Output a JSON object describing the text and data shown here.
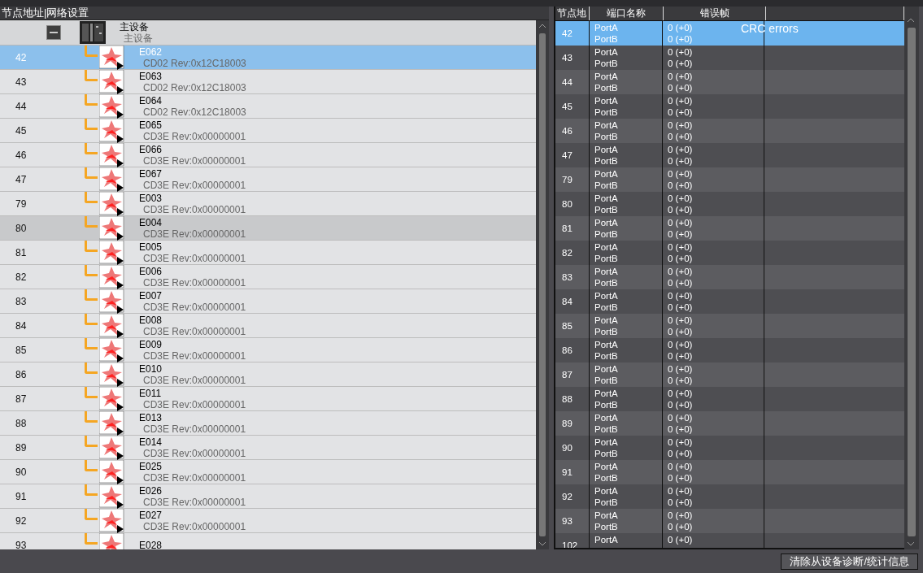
{
  "left_panel": {
    "header": "节点地址|网络设置",
    "master": {
      "name": "主设备",
      "subtitle": "主设备",
      "expanded": true
    },
    "rows": [
      {
        "node": "42",
        "name": "E062",
        "desc": "CD02 Rev:0x12C18003",
        "selected": true,
        "hovered": false
      },
      {
        "node": "43",
        "name": "E063",
        "desc": "CD02 Rev:0x12C18003",
        "selected": false,
        "hovered": false
      },
      {
        "node": "44",
        "name": "E064",
        "desc": "CD02 Rev:0x12C18003",
        "selected": false,
        "hovered": false
      },
      {
        "node": "45",
        "name": "E065",
        "desc": "CD3E Rev:0x00000001",
        "selected": false,
        "hovered": false
      },
      {
        "node": "46",
        "name": "E066",
        "desc": "CD3E Rev:0x00000001",
        "selected": false,
        "hovered": false
      },
      {
        "node": "47",
        "name": "E067",
        "desc": "CD3E Rev:0x00000001",
        "selected": false,
        "hovered": false
      },
      {
        "node": "79",
        "name": "E003",
        "desc": "CD3E Rev:0x00000001",
        "selected": false,
        "hovered": false
      },
      {
        "node": "80",
        "name": "E004",
        "desc": "CD3E Rev:0x00000001",
        "selected": false,
        "hovered": true
      },
      {
        "node": "81",
        "name": "E005",
        "desc": "CD3E Rev:0x00000001",
        "selected": false,
        "hovered": false
      },
      {
        "node": "82",
        "name": "E006",
        "desc": "CD3E Rev:0x00000001",
        "selected": false,
        "hovered": false
      },
      {
        "node": "83",
        "name": "E007",
        "desc": "CD3E Rev:0x00000001",
        "selected": false,
        "hovered": false
      },
      {
        "node": "84",
        "name": "E008",
        "desc": "CD3E Rev:0x00000001",
        "selected": false,
        "hovered": false
      },
      {
        "node": "85",
        "name": "E009",
        "desc": "CD3E Rev:0x00000001",
        "selected": false,
        "hovered": false
      },
      {
        "node": "86",
        "name": "E010",
        "desc": "CD3E Rev:0x00000001",
        "selected": false,
        "hovered": false
      },
      {
        "node": "87",
        "name": "E011",
        "desc": "CD3E Rev:0x00000001",
        "selected": false,
        "hovered": false
      },
      {
        "node": "88",
        "name": "E013",
        "desc": "CD3E Rev:0x00000001",
        "selected": false,
        "hovered": false
      },
      {
        "node": "89",
        "name": "E014",
        "desc": "CD3E Rev:0x00000001",
        "selected": false,
        "hovered": false
      },
      {
        "node": "90",
        "name": "E025",
        "desc": "CD3E Rev:0x00000001",
        "selected": false,
        "hovered": false
      },
      {
        "node": "91",
        "name": "E026",
        "desc": "CD3E Rev:0x00000001",
        "selected": false,
        "hovered": false
      },
      {
        "node": "92",
        "name": "E027",
        "desc": "CD3E Rev:0x00000001",
        "selected": false,
        "hovered": false
      },
      {
        "node": "93",
        "name": "E028",
        "selected": false,
        "hovered": false
      }
    ]
  },
  "right_panel": {
    "columns": [
      "节点地",
      "端口名称",
      "错误帧"
    ],
    "tooltip": "CRC errors",
    "rows": [
      {
        "node": "42",
        "ports": [
          "PortA",
          "PortB"
        ],
        "errors": [
          "0 (+0)",
          "0 (+0)"
        ],
        "selected": true
      },
      {
        "node": "43",
        "ports": [
          "PortA",
          "PortB"
        ],
        "errors": [
          "0 (+0)",
          "0 (+0)"
        ],
        "selected": false
      },
      {
        "node": "44",
        "ports": [
          "PortA",
          "PortB"
        ],
        "errors": [
          "0 (+0)",
          "0 (+0)"
        ],
        "selected": false
      },
      {
        "node": "45",
        "ports": [
          "PortA",
          "PortB"
        ],
        "errors": [
          "0 (+0)",
          "0 (+0)"
        ],
        "selected": false
      },
      {
        "node": "46",
        "ports": [
          "PortA",
          "PortB"
        ],
        "errors": [
          "0 (+0)",
          "0 (+0)"
        ],
        "selected": false
      },
      {
        "node": "47",
        "ports": [
          "PortA",
          "PortB"
        ],
        "errors": [
          "0 (+0)",
          "0 (+0)"
        ],
        "selected": false
      },
      {
        "node": "79",
        "ports": [
          "PortA",
          "PortB"
        ],
        "errors": [
          "0 (+0)",
          "0 (+0)"
        ],
        "selected": false
      },
      {
        "node": "80",
        "ports": [
          "PortA",
          "PortB"
        ],
        "errors": [
          "0 (+0)",
          "0 (+0)"
        ],
        "selected": false
      },
      {
        "node": "81",
        "ports": [
          "PortA",
          "PortB"
        ],
        "errors": [
          "0 (+0)",
          "0 (+0)"
        ],
        "selected": false
      },
      {
        "node": "82",
        "ports": [
          "PortA",
          "PortB"
        ],
        "errors": [
          "0 (+0)",
          "0 (+0)"
        ],
        "selected": false
      },
      {
        "node": "83",
        "ports": [
          "PortA",
          "PortB"
        ],
        "errors": [
          "0 (+0)",
          "0 (+0)"
        ],
        "selected": false
      },
      {
        "node": "84",
        "ports": [
          "PortA",
          "PortB"
        ],
        "errors": [
          "0 (+0)",
          "0 (+0)"
        ],
        "selected": false
      },
      {
        "node": "85",
        "ports": [
          "PortA",
          "PortB"
        ],
        "errors": [
          "0 (+0)",
          "0 (+0)"
        ],
        "selected": false
      },
      {
        "node": "86",
        "ports": [
          "PortA",
          "PortB"
        ],
        "errors": [
          "0 (+0)",
          "0 (+0)"
        ],
        "selected": false
      },
      {
        "node": "87",
        "ports": [
          "PortA",
          "PortB"
        ],
        "errors": [
          "0 (+0)",
          "0 (+0)"
        ],
        "selected": false
      },
      {
        "node": "88",
        "ports": [
          "PortA",
          "PortB"
        ],
        "errors": [
          "0 (+0)",
          "0 (+0)"
        ],
        "selected": false
      },
      {
        "node": "89",
        "ports": [
          "PortA",
          "PortB"
        ],
        "errors": [
          "0 (+0)",
          "0 (+0)"
        ],
        "selected": false
      },
      {
        "node": "90",
        "ports": [
          "PortA",
          "PortB"
        ],
        "errors": [
          "0 (+0)",
          "0 (+0)"
        ],
        "selected": false
      },
      {
        "node": "91",
        "ports": [
          "PortA",
          "PortB"
        ],
        "errors": [
          "0 (+0)",
          "0 (+0)"
        ],
        "selected": false
      },
      {
        "node": "92",
        "ports": [
          "PortA",
          "PortB"
        ],
        "errors": [
          "0 (+0)",
          "0 (+0)"
        ],
        "selected": false
      },
      {
        "node": "93",
        "ports": [
          "PortA",
          "PortB"
        ],
        "errors": [
          "0 (+0)",
          "0 (+0)"
        ],
        "selected": false
      },
      {
        "node": "102",
        "ports": [
          "PortA"
        ],
        "errors": [
          "0 (+0)"
        ],
        "selected": false
      }
    ]
  },
  "clear_button": "清除从设备诊断/统计信息"
}
